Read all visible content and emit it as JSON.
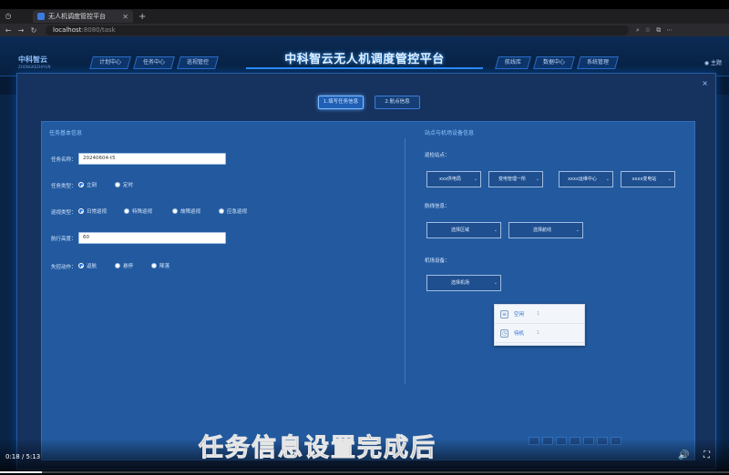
{
  "browser": {
    "tab_title": "无人机调度管控平台",
    "url_host": "localhost",
    "url_path": ":8080/task"
  },
  "header": {
    "logo": "中科智云",
    "logo_sub": "ZHONGKEZHIYUN",
    "title": "中科智云无人机调度管控平台",
    "nav_left": [
      "计划中心",
      "任务中心",
      "巡视管控"
    ],
    "nav_right": [
      "航线库",
      "数据中心",
      "系统管理"
    ],
    "user": "主题"
  },
  "modal": {
    "close": "×",
    "steps": [
      "1.填写任务信息",
      "2.航点信息"
    ],
    "left_section": "任务基本信息",
    "right_section": "站点与机场设备信息",
    "task_name_label": "任务名称：",
    "task_name_value": "20240604-t5",
    "task_type_label": "任务类型：",
    "task_type_options": [
      "立刻",
      "定时"
    ],
    "patrol_type_label": "巡视类型：",
    "patrol_type_options": [
      "日常巡视",
      "特殊巡视",
      "故障巡视",
      "应急巡视"
    ],
    "height_label": "航行高度：",
    "height_value": "60",
    "lost_action_label": "失控动作：",
    "lost_action_options": [
      "返航",
      "悬停",
      "降落"
    ],
    "patrol_site_label": "巡检站点：",
    "patrol_site_selects": [
      "xxx供电局",
      "变电管理一所",
      "xxxx运维中心",
      "xxxx变电站"
    ],
    "patrol_area_label": "航线信息：",
    "patrol_area_selects": [
      "选择区域",
      "选择航线"
    ],
    "device_label": "机场设备：",
    "device_select": "选择机场",
    "dropdown": [
      {
        "label": "空闲",
        "count": "1"
      },
      {
        "label": "待机",
        "count": "1"
      }
    ]
  },
  "subtitle": "任务信息设置完成后",
  "video": {
    "time": "0:18 / 5:13",
    "progress": 0.057
  }
}
